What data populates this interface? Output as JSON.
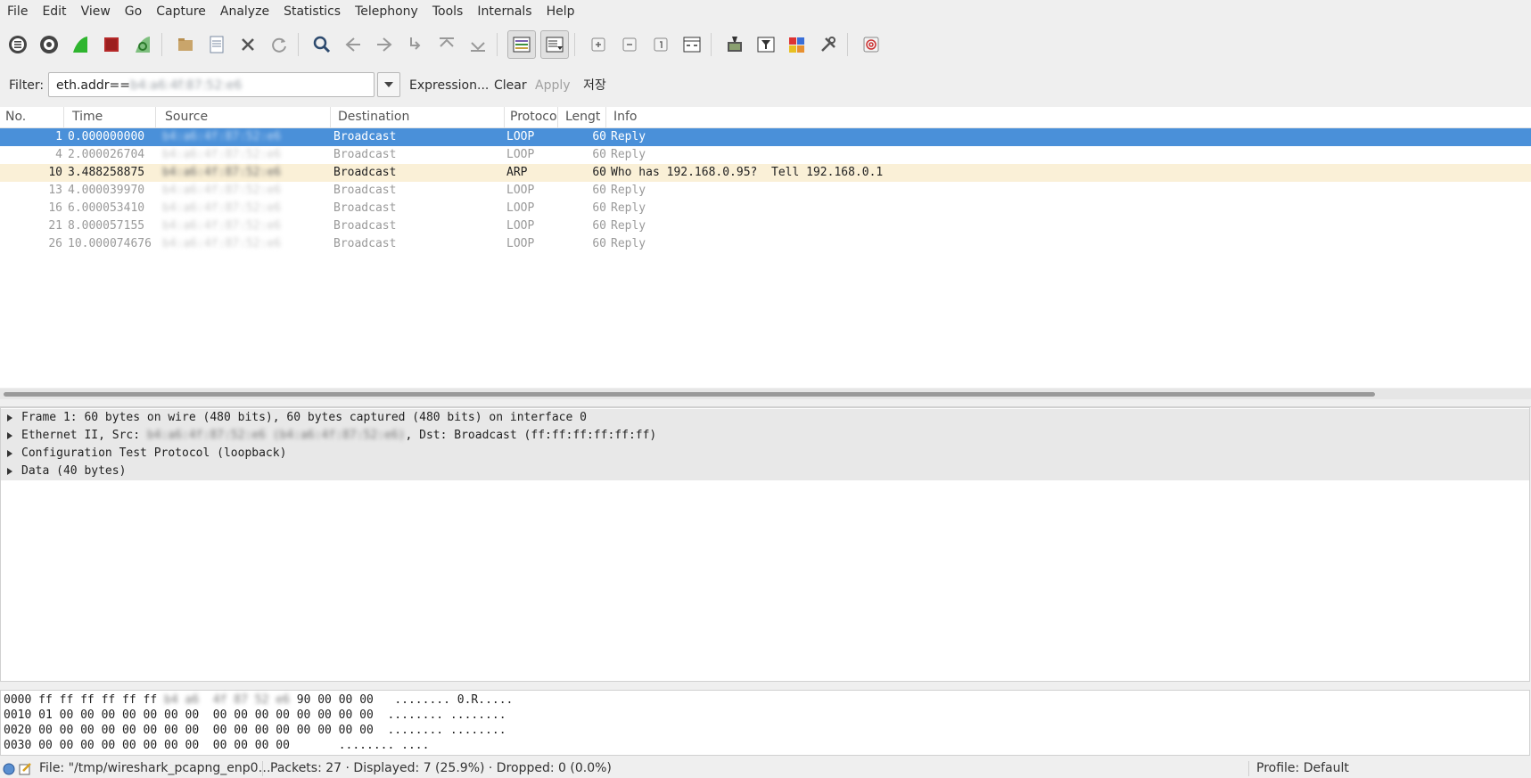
{
  "menu": [
    "File",
    "Edit",
    "View",
    "Go",
    "Capture",
    "Analyze",
    "Statistics",
    "Telephony",
    "Tools",
    "Internals",
    "Help"
  ],
  "toolbar": {
    "icons": [
      "interfaces-icon",
      "options-icon",
      "start-capture-icon",
      "stop-capture-icon",
      "restart-capture-icon",
      "open-file-icon",
      "save-file-icon",
      "close-file-icon",
      "reload-icon",
      "find-packet-icon",
      "go-back-icon",
      "go-forward-icon",
      "go-to-packet-icon",
      "first-packet-icon",
      "last-packet-icon",
      "colorize-icon",
      "auto-scroll-icon",
      "zoom-in-icon",
      "zoom-out-icon",
      "normal-size-icon",
      "resize-columns-icon",
      "capture-filters-icon",
      "display-filters-icon",
      "coloring-rules-icon",
      "preferences-icon",
      "help-icon"
    ]
  },
  "filter": {
    "label": "Filter:",
    "value_prefix": "eth.addr==",
    "value_blurred": "b4:a6:4f:87:52:e6",
    "expression": "Expression...",
    "clear": "Clear",
    "apply": "Apply",
    "save": "저장"
  },
  "columns": [
    "No.",
    "Time",
    "Source",
    "Destination",
    "Protocol",
    "Lengt",
    "Info"
  ],
  "packets": [
    {
      "no": "1",
      "time": "0.000000000",
      "source": "b4:a6:4f:87:52:e6",
      "dest": "Broadcast",
      "proto": "LOOP",
      "len": "60",
      "info": "Reply",
      "style": "sel"
    },
    {
      "no": "4",
      "time": "2.000026704",
      "source": "b4:a6:4f:87:52:e6",
      "dest": "Broadcast",
      "proto": "LOOP",
      "len": "60",
      "info": "Reply",
      "style": "dim"
    },
    {
      "no": "10",
      "time": "3.488258875",
      "source": "b4:a6:4f:87:52:e6",
      "dest": "Broadcast",
      "proto": "ARP",
      "len": "60",
      "info": "Who has 192.168.0.95?  Tell 192.168.0.1",
      "style": "arp"
    },
    {
      "no": "13",
      "time": "4.000039970",
      "source": "b4:a6:4f:87:52:e6",
      "dest": "Broadcast",
      "proto": "LOOP",
      "len": "60",
      "info": "Reply",
      "style": "dim"
    },
    {
      "no": "16",
      "time": "6.000053410",
      "source": "b4:a6:4f:87:52:e6",
      "dest": "Broadcast",
      "proto": "LOOP",
      "len": "60",
      "info": "Reply",
      "style": "dim"
    },
    {
      "no": "21",
      "time": "8.000057155",
      "source": "b4:a6:4f:87:52:e6",
      "dest": "Broadcast",
      "proto": "LOOP",
      "len": "60",
      "info": "Reply",
      "style": "dim"
    },
    {
      "no": "26",
      "time": "10.000074676",
      "source": "b4:a6:4f:87:52:e6",
      "dest": "Broadcast",
      "proto": "LOOP",
      "len": "60",
      "info": "Reply",
      "style": "dim"
    }
  ],
  "details": [
    {
      "text": "Frame 1: 60 bytes on wire (480 bits), 60 bytes captured (480 bits) on interface 0"
    },
    {
      "text_a": "Ethernet II, Src: ",
      "blur": "b4:a6:4f:87:52:e6 (b4:a6:4f:87:52:e6)",
      "text_b": ", Dst: Broadcast (ff:ff:ff:ff:ff:ff)"
    },
    {
      "text": "Configuration Test Protocol (loopback)"
    },
    {
      "text": "Data (40 bytes)"
    }
  ],
  "bytes": [
    {
      "offset": "0000",
      "hex_a": " ff ff ff ff ff ff ",
      "hex_blur": "b4 a6  4f 87 52 e6",
      "hex_b": " 90 00 00 00",
      "ascii": "   ........ 0.R....."
    },
    {
      "offset": "0010",
      "hex_a": " 01 00 00 00 00 00 00 00  00 00 00 00 00 00 00 00",
      "ascii": "  ........ ........"
    },
    {
      "offset": "0020",
      "hex_a": " 00 00 00 00 00 00 00 00  00 00 00 00 00 00 00 00",
      "ascii": "  ........ ........"
    },
    {
      "offset": "0030",
      "hex_a": " 00 00 00 00 00 00 00 00  00 00 00 00",
      "ascii": "       ........ ...."
    }
  ],
  "status": {
    "file": "File: \"/tmp/wireshark_pcapng_enp0…",
    "packets": "Packets: 27 · Displayed: 7 (25.9%)  · Dropped: 0 (0.0%)",
    "profile": "Profile: Default"
  }
}
